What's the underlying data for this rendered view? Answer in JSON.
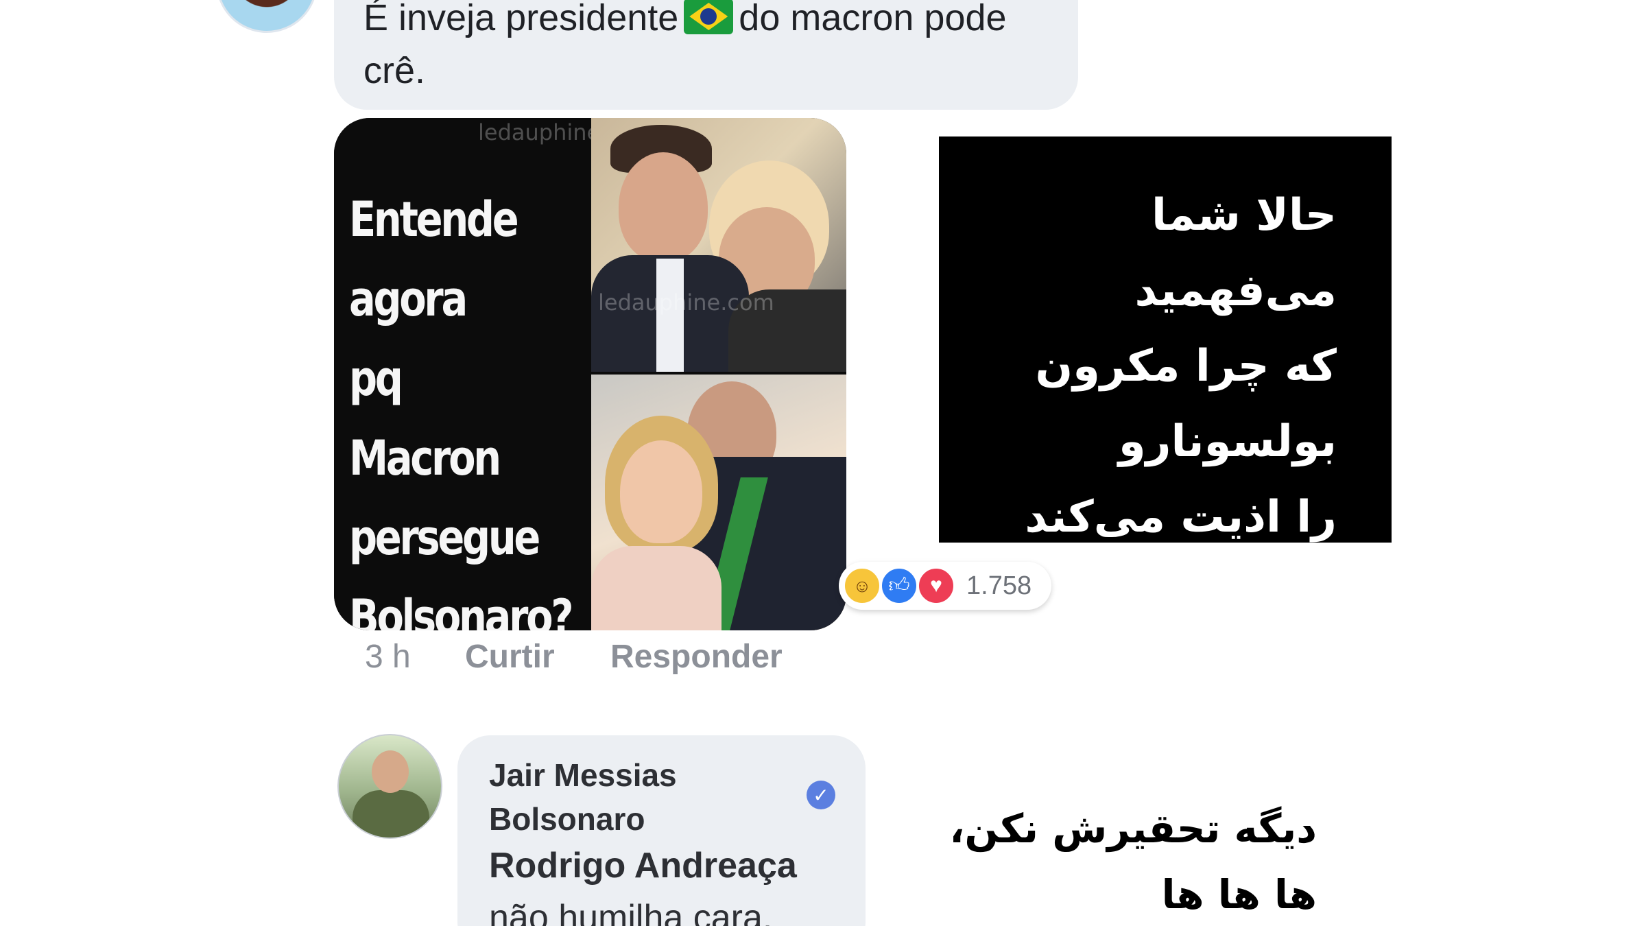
{
  "top_comment": {
    "text_before_flag": "É inveja presidente",
    "flag_icon": "brazil-flag-icon",
    "text_after_flag": "do macron pode crê."
  },
  "meme": {
    "caption_lines": [
      "Entende",
      "agora",
      "pq Macron",
      "persegue",
      "Bolsonaro?"
    ],
    "watermark": "ledauphine.com"
  },
  "reactions": {
    "icons": [
      "haha-icon",
      "like-icon",
      "love-icon"
    ],
    "count": "1.758"
  },
  "actions": {
    "time": "3 h",
    "like_label": "Curtir",
    "reply_label": "Responder"
  },
  "overlay": {
    "lines": [
      "حالا شما می‌فهمید",
      "که چرا مکرون",
      "بولسونارو",
      "را اذیت می‌کند"
    ]
  },
  "reply_comment": {
    "author_line1": "Jair Messias",
    "author_line2": "Bolsonaro",
    "verified_icon": "verified-badge-icon",
    "mention": "Rodrigo Andreaça",
    "text": "não humilha cara."
  },
  "persian_caption": {
    "line1": "دیگه تحقیرش نکن،",
    "line2": "ها ها ها"
  },
  "colors": {
    "bubble": "#eceff3",
    "verified": "#5b7fe0",
    "like": "#2f7cf3",
    "love": "#ee3d55",
    "haha": "#f7c53a",
    "meta_text": "#8c9098"
  }
}
